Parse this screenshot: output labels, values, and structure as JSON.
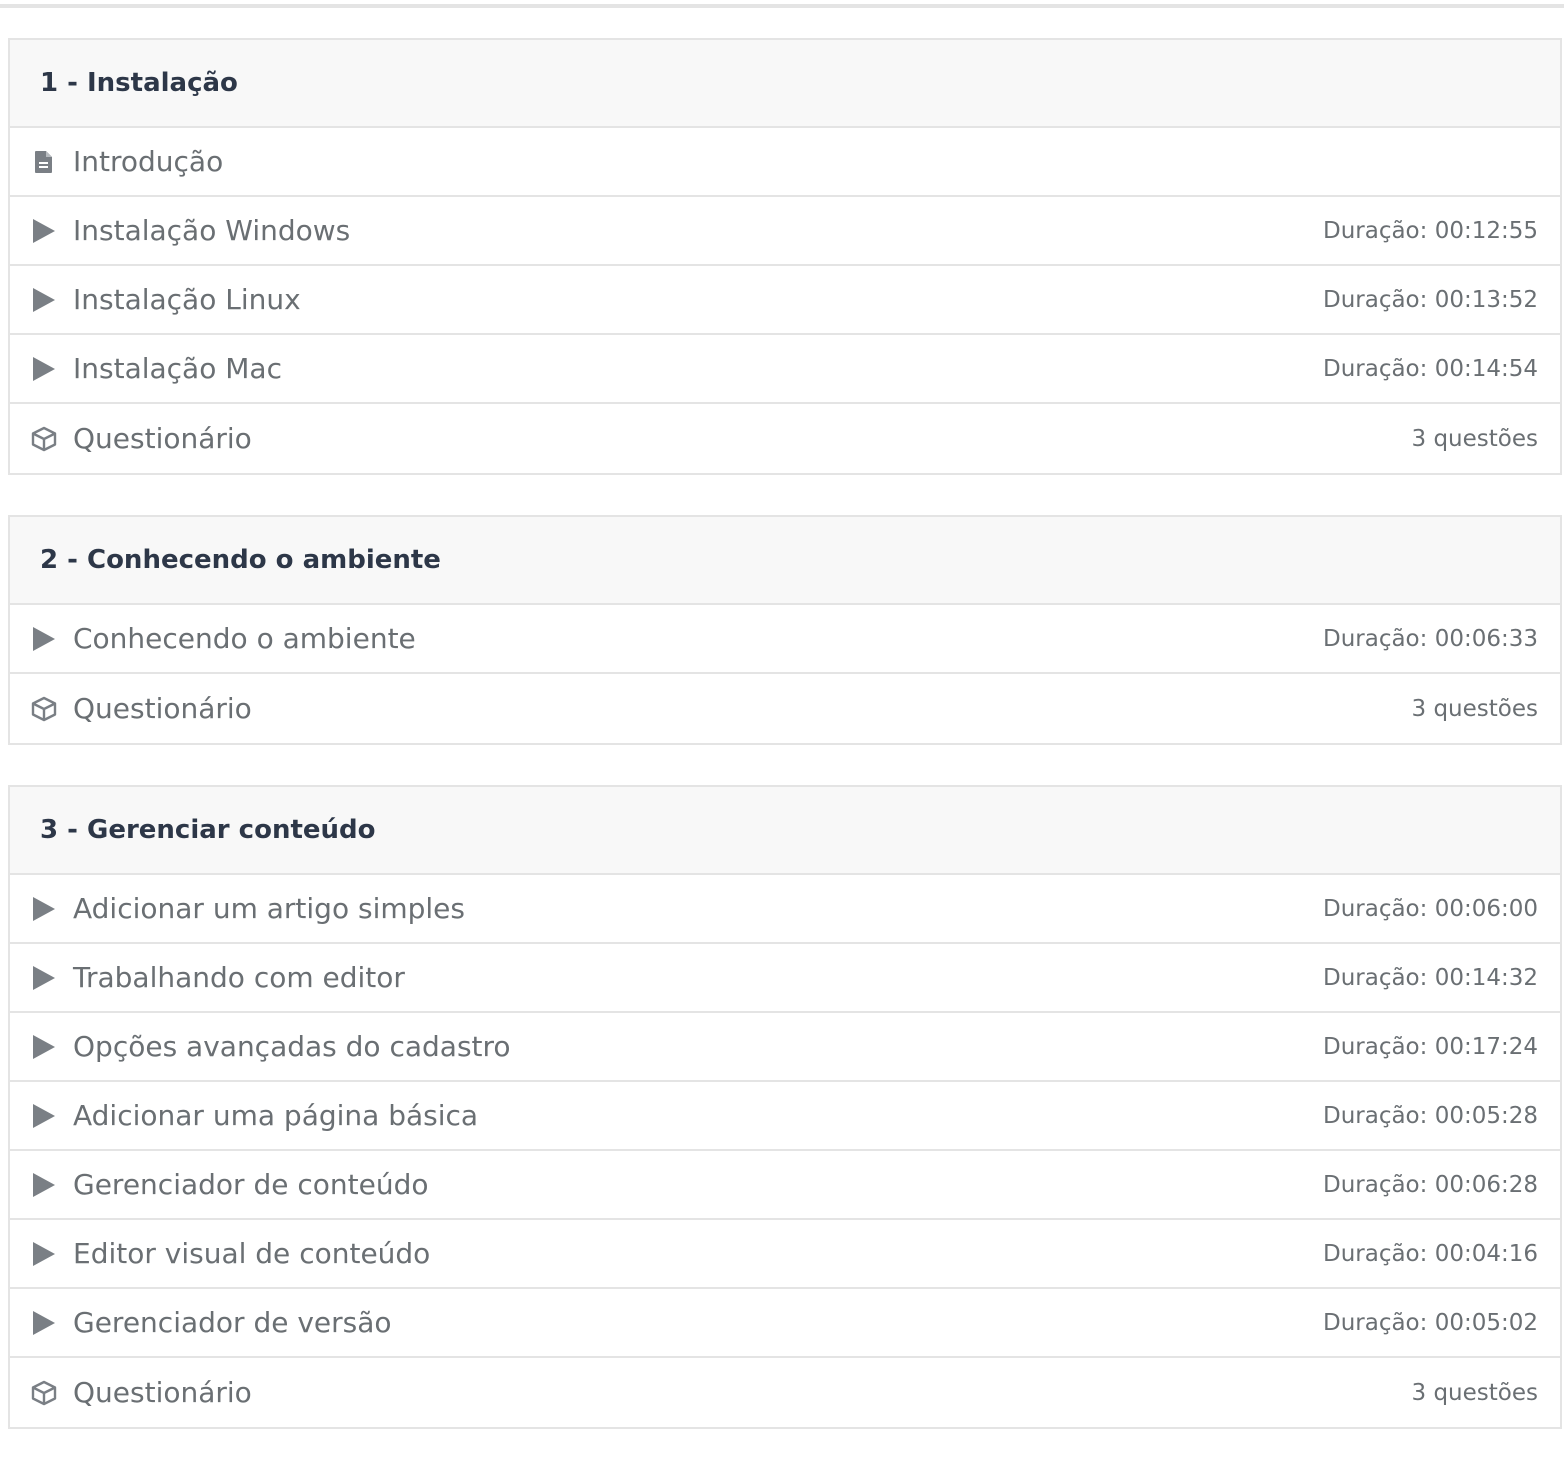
{
  "sections": [
    {
      "title": "1 - Instalação",
      "items": [
        {
          "type": "document",
          "icon": "document-icon",
          "label": "Introdução",
          "meta": ""
        },
        {
          "type": "video",
          "icon": "play-icon",
          "label": "Instalação Windows",
          "meta": "Duração: 00:12:55"
        },
        {
          "type": "video",
          "icon": "play-icon",
          "label": "Instalação Linux",
          "meta": "Duração: 00:13:52"
        },
        {
          "type": "video",
          "icon": "play-icon",
          "label": "Instalação Mac",
          "meta": "Duração: 00:14:54"
        },
        {
          "type": "quiz",
          "icon": "cube-icon",
          "label": "Questionário",
          "meta": "3 questões"
        }
      ]
    },
    {
      "title": "2 - Conhecendo o ambiente",
      "items": [
        {
          "type": "video",
          "icon": "play-icon",
          "label": "Conhecendo o ambiente",
          "meta": "Duração: 00:06:33"
        },
        {
          "type": "quiz",
          "icon": "cube-icon",
          "label": "Questionário",
          "meta": "3 questões"
        }
      ]
    },
    {
      "title": "3 - Gerenciar conteúdo",
      "items": [
        {
          "type": "video",
          "icon": "play-icon",
          "label": "Adicionar um artigo simples",
          "meta": "Duração: 00:06:00"
        },
        {
          "type": "video",
          "icon": "play-icon",
          "label": "Trabalhando com editor",
          "meta": "Duração: 00:14:32"
        },
        {
          "type": "video",
          "icon": "play-icon",
          "label": "Opções avançadas do cadastro",
          "meta": "Duração: 00:17:24"
        },
        {
          "type": "video",
          "icon": "play-icon",
          "label": "Adicionar uma página básica",
          "meta": "Duração: 00:05:28"
        },
        {
          "type": "video",
          "icon": "play-icon",
          "label": "Gerenciador de conteúdo",
          "meta": "Duração: 00:06:28"
        },
        {
          "type": "video",
          "icon": "play-icon",
          "label": "Editor visual de conteúdo",
          "meta": "Duração: 00:04:16"
        },
        {
          "type": "video",
          "icon": "play-icon",
          "label": "Gerenciador de versão",
          "meta": "Duração: 00:05:02"
        },
        {
          "type": "quiz",
          "icon": "cube-icon",
          "label": "Questionário",
          "meta": "3 questões"
        }
      ]
    }
  ],
  "colors": {
    "title": "#2d3748",
    "text": "#6a6f73",
    "icon": "#7a7f85",
    "border": "#e4e4e4",
    "header_bg": "#f8f8f8"
  }
}
